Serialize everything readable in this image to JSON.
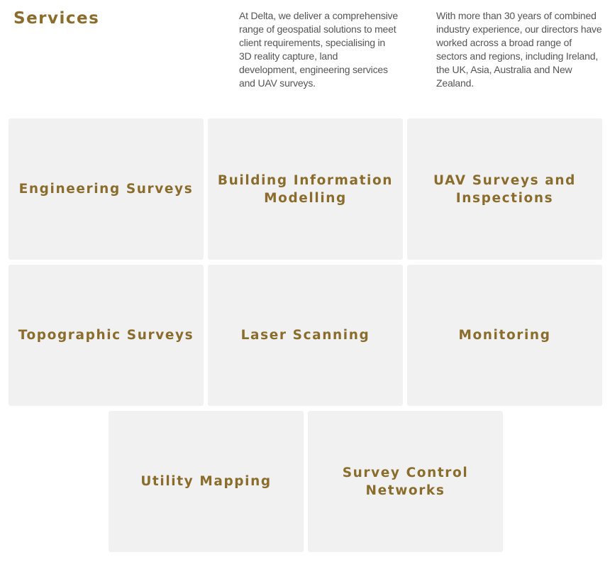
{
  "section": {
    "title": "Services"
  },
  "intro": {
    "paragraph_1": "At Delta, we deliver a comprehensive range of geospatial solutions to meet client requirements, specialising in 3D reality capture, land development, engineering services and UAV surveys.",
    "paragraph_2": "With more than 30 years of combined industry experience, our directors have worked across a broad range of sectors and regions, including Ireland, the UK, Asia, Australia and New Zealand."
  },
  "services": [
    {
      "label": "Engineering Surveys"
    },
    {
      "label": "Building Information Modelling"
    },
    {
      "label": "UAV Surveys and Inspections"
    },
    {
      "label": "Topographic Surveys"
    },
    {
      "label": "Laser Scanning"
    },
    {
      "label": "Monitoring"
    },
    {
      "label": "Utility Mapping"
    },
    {
      "label": "Survey Control Networks"
    }
  ],
  "colors": {
    "accent": "#8a6d2c",
    "card_background": "#f1f1f1",
    "body_text": "#555555"
  }
}
